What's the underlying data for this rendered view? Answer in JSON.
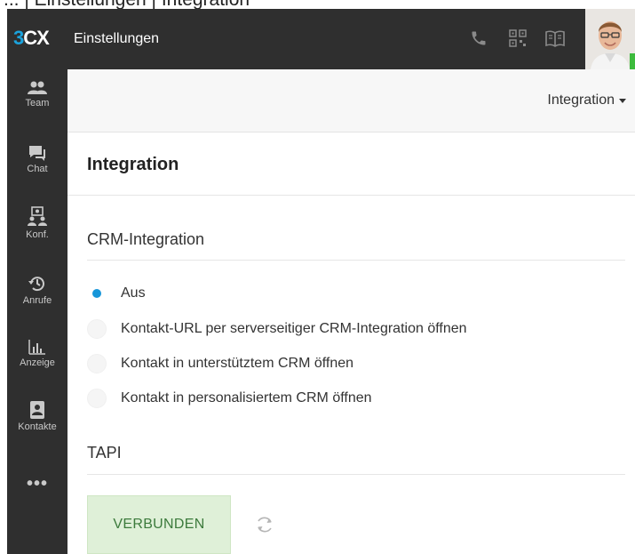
{
  "breadcrumb": {
    "text": "... | Einstellungen | Integration"
  },
  "header": {
    "logo_three": "3",
    "logo_cx": "CX",
    "title": "Einstellungen",
    "icons": [
      "phone-icon",
      "qr-code-icon",
      "book-icon"
    ]
  },
  "sidebar": {
    "items": [
      {
        "label": "Team",
        "icon": "team-icon"
      },
      {
        "label": "Chat",
        "icon": "chat-icon"
      },
      {
        "label": "Konf.",
        "icon": "conference-icon"
      },
      {
        "label": "Anrufe",
        "icon": "history-icon"
      },
      {
        "label": "Anzeige",
        "icon": "chart-icon"
      },
      {
        "label": "Kontakte",
        "icon": "contacts-icon"
      }
    ],
    "more": "•••"
  },
  "subbar": {
    "dropdown_label": "Integration"
  },
  "main": {
    "title": "Integration",
    "crm_section": "CRM-Integration",
    "crm_options": [
      {
        "label": "Aus",
        "checked": true
      },
      {
        "label": "Kontakt-URL per serverseitiger CRM-Integration öffnen",
        "checked": false
      },
      {
        "label": "Kontakt in unterstütztem CRM öffnen",
        "checked": false
      },
      {
        "label": "Kontakt in personalisiertem CRM öffnen",
        "checked": false
      }
    ],
    "tapi_section": "TAPI",
    "tapi_status": "VERBUNDEN"
  },
  "colors": {
    "accent": "#1ba3dd",
    "radio_selected": "#1796d9",
    "sidebar_bg": "#2f2f2f",
    "connected_bg": "#dff0d8",
    "connected_text": "#3c7a3c",
    "presence": "#3dbb3d"
  }
}
